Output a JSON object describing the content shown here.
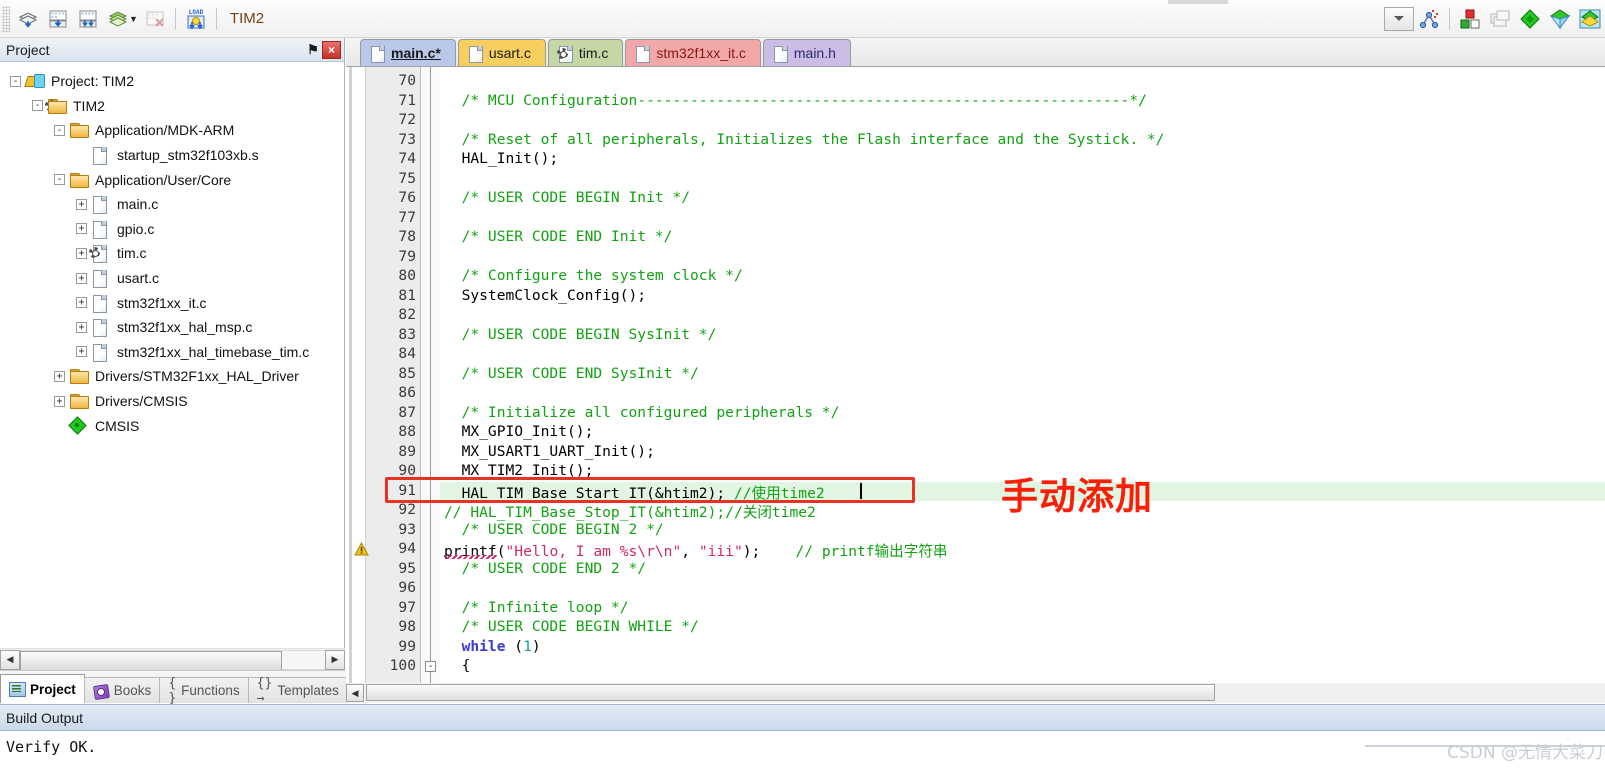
{
  "toolbar": {
    "project_name": "TIM2",
    "buttons": [
      {
        "name": "build-icon",
        "title": "Translate"
      },
      {
        "name": "build-target-icon",
        "title": "Build"
      },
      {
        "name": "rebuild-all-icon",
        "title": "Rebuild"
      },
      {
        "name": "batch-build-icon",
        "title": "Batch Build"
      },
      {
        "name": "stop-build-icon",
        "title": "Stop Build"
      },
      {
        "name": "load-icon",
        "title": "Download"
      }
    ],
    "right_buttons": [
      {
        "name": "target-options-icon",
        "title": "Target Options"
      },
      {
        "name": "manage-components-icon",
        "title": "Manage Components"
      },
      {
        "name": "multi-project-icon",
        "title": "Multi-Project"
      },
      {
        "name": "pack-installer-icon",
        "title": "Pack Installer"
      },
      {
        "name": "manage-rte-icon",
        "title": "Manage RTE"
      },
      {
        "name": "svcs-icon",
        "title": "Configure Run-Time Env"
      }
    ],
    "combo_value": ""
  },
  "project_panel": {
    "title": "Project",
    "pin_glyph": "⚑",
    "close_glyph": "×",
    "tree": [
      {
        "depth": 0,
        "label": "Project: TIM2",
        "icon": "project-icon",
        "expander": "-"
      },
      {
        "depth": 1,
        "label": "TIM2",
        "icon": "folder-gear-icon",
        "expander": "-"
      },
      {
        "depth": 2,
        "label": "Application/MDK-ARM",
        "icon": "folder-icon",
        "expander": "-"
      },
      {
        "depth": 3,
        "label": "startup_stm32f103xb.s",
        "icon": "file-icon",
        "expander": ""
      },
      {
        "depth": 2,
        "label": "Application/User/Core",
        "icon": "folder-icon",
        "expander": "-"
      },
      {
        "depth": 3,
        "label": "main.c",
        "icon": "file-icon",
        "expander": "+"
      },
      {
        "depth": 3,
        "label": "gpio.c",
        "icon": "file-icon",
        "expander": "+"
      },
      {
        "depth": 3,
        "label": "tim.c",
        "icon": "file-gear-icon",
        "expander": "+"
      },
      {
        "depth": 3,
        "label": "usart.c",
        "icon": "file-icon",
        "expander": "+"
      },
      {
        "depth": 3,
        "label": "stm32f1xx_it.c",
        "icon": "file-icon",
        "expander": "+"
      },
      {
        "depth": 3,
        "label": "stm32f1xx_hal_msp.c",
        "icon": "file-icon",
        "expander": "+"
      },
      {
        "depth": 3,
        "label": "stm32f1xx_hal_timebase_tim.c",
        "icon": "file-icon",
        "expander": "+"
      },
      {
        "depth": 2,
        "label": "Drivers/STM32F1xx_HAL_Driver",
        "icon": "folder-icon",
        "expander": "+"
      },
      {
        "depth": 2,
        "label": "Drivers/CMSIS",
        "icon": "folder-icon",
        "expander": "+"
      },
      {
        "depth": 2,
        "label": "CMSIS",
        "icon": "diamond-icon",
        "expander": ""
      }
    ],
    "tabs": [
      {
        "label": "Project",
        "icon": "project-tab-icon",
        "active": true
      },
      {
        "label": "Books",
        "icon": "books-icon",
        "active": false
      },
      {
        "label": "Functions",
        "icon": "braces-icon",
        "active": false,
        "glyph": "{ }"
      },
      {
        "label": "Templates",
        "icon": "templates-icon",
        "active": false,
        "glyph": "{}→"
      }
    ]
  },
  "editor": {
    "tabs": [
      {
        "label": "main.c*",
        "active": true,
        "bg": "#b9c8e8",
        "fg": "#1a1a1a"
      },
      {
        "label": "usart.c",
        "active": false,
        "bg": "#f7cf5e",
        "fg": "#1a1a1a"
      },
      {
        "label": "tim.c",
        "active": false,
        "bg": "#c5d7a4",
        "fg": "#1a1a1a",
        "icon": "file-gear-icon"
      },
      {
        "label": "stm32f1xx_it.c",
        "active": false,
        "bg": "#f2a8a8",
        "fg": "#8a1515"
      },
      {
        "label": "main.h",
        "active": false,
        "bg": "#cbbde6",
        "fg": "#2b2b6e"
      }
    ],
    "annotation": "手动添加",
    "lines": [
      {
        "n": 70,
        "segments": []
      },
      {
        "n": 71,
        "segments": [
          {
            "t": "  /* MCU Configuration--------------------------------------------------------*/",
            "c": "cm"
          }
        ]
      },
      {
        "n": 72,
        "segments": []
      },
      {
        "n": 73,
        "segments": [
          {
            "t": "  /* Reset of all peripherals, Initializes the Flash interface and the Systick. */",
            "c": "cm"
          }
        ]
      },
      {
        "n": 74,
        "segments": [
          {
            "t": "  HAL_Init();",
            "c": "pl"
          }
        ]
      },
      {
        "n": 75,
        "segments": []
      },
      {
        "n": 76,
        "segments": [
          {
            "t": "  /* USER CODE BEGIN Init */",
            "c": "cm"
          }
        ]
      },
      {
        "n": 77,
        "segments": []
      },
      {
        "n": 78,
        "segments": [
          {
            "t": "  /* USER CODE END Init */",
            "c": "cm"
          }
        ]
      },
      {
        "n": 79,
        "segments": []
      },
      {
        "n": 80,
        "segments": [
          {
            "t": "  /* Configure the system clock */",
            "c": "cm"
          }
        ]
      },
      {
        "n": 81,
        "segments": [
          {
            "t": "  SystemClock_Config();",
            "c": "pl"
          }
        ]
      },
      {
        "n": 82,
        "segments": []
      },
      {
        "n": 83,
        "segments": [
          {
            "t": "  /* USER CODE BEGIN SysInit */",
            "c": "cm"
          }
        ]
      },
      {
        "n": 84,
        "segments": []
      },
      {
        "n": 85,
        "segments": [
          {
            "t": "  /* USER CODE END SysInit */",
            "c": "cm"
          }
        ]
      },
      {
        "n": 86,
        "segments": []
      },
      {
        "n": 87,
        "segments": [
          {
            "t": "  /* Initialize all configured peripherals */",
            "c": "cm"
          }
        ]
      },
      {
        "n": 88,
        "segments": [
          {
            "t": "  MX_GPIO_Init();",
            "c": "pl"
          }
        ]
      },
      {
        "n": 89,
        "segments": [
          {
            "t": "  MX_USART1_UART_Init();",
            "c": "pl"
          }
        ]
      },
      {
        "n": 90,
        "segments": [
          {
            "t": "  MX_TIM2_Init();",
            "c": "pl"
          }
        ]
      },
      {
        "n": 91,
        "highlight": true,
        "segments": [
          {
            "t": "  HAL_TIM_Base_Start_IT(&htim2); ",
            "c": "pl"
          },
          {
            "t": "//使用time2",
            "c": "cm"
          }
        ]
      },
      {
        "n": 92,
        "segments": [
          {
            "t": "// HAL_TIM_Base_Stop_IT(&htim2);//关闭time2",
            "c": "cm"
          }
        ]
      },
      {
        "n": 93,
        "segments": [
          {
            "t": "  /* USER CODE BEGIN 2 */",
            "c": "cm"
          }
        ]
      },
      {
        "n": 94,
        "warn": true,
        "segments": [
          {
            "t": "printf(",
            "c": "pl"
          },
          {
            "t": "\"Hello, I am %s\\r\\n\"",
            "c": "str"
          },
          {
            "t": ", ",
            "c": "pl"
          },
          {
            "t": "\"iii\"",
            "c": "str"
          },
          {
            "t": ");    ",
            "c": "pl"
          },
          {
            "t": "// printf输出字符串",
            "c": "cm"
          }
        ]
      },
      {
        "n": 95,
        "segments": [
          {
            "t": "  /* USER CODE END 2 */",
            "c": "cm"
          }
        ]
      },
      {
        "n": 96,
        "segments": []
      },
      {
        "n": 97,
        "segments": [
          {
            "t": "  /* Infinite loop */",
            "c": "cm"
          }
        ]
      },
      {
        "n": 98,
        "segments": [
          {
            "t": "  /* USER CODE BEGIN WHILE */",
            "c": "cm"
          }
        ]
      },
      {
        "n": 99,
        "segments": [
          {
            "t": "  ",
            "c": "pl"
          },
          {
            "t": "while",
            "c": "kw"
          },
          {
            "t": " (",
            "c": "pl"
          },
          {
            "t": "1",
            "c": "num-lit"
          },
          {
            "t": ")",
            "c": "pl"
          }
        ]
      },
      {
        "n": 100,
        "fold": "-",
        "segments": [
          {
            "t": "  {",
            "c": "pl"
          }
        ]
      }
    ]
  },
  "build_output": {
    "title": "Build Output",
    "text": "Verify OK."
  },
  "watermark": "CSDN @无情大菜刀",
  "colors": {
    "comment_green": "#12a312",
    "keyword_blue": "#3a3ad6",
    "string_pink": "#cf2a6b",
    "annotation_red": "#f81f06",
    "highlight_green": "#e2f5e2",
    "redbox": "#e83323"
  }
}
